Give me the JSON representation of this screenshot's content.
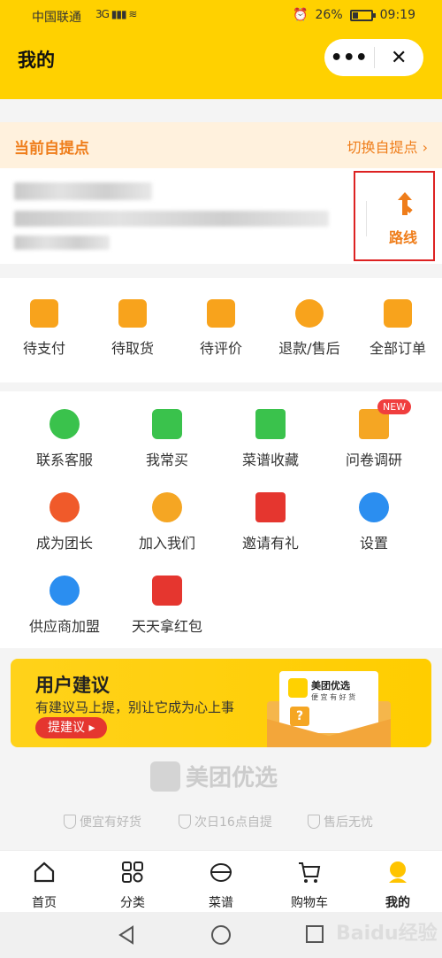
{
  "status": {
    "carrier": "中国联通",
    "network": "3G",
    "battery": "26%",
    "time": "09:19"
  },
  "header": {
    "title": "我的",
    "more": "•••",
    "close": "✕"
  },
  "pickup": {
    "label": "当前自提点",
    "switch": "切换自提点",
    "route": "路线"
  },
  "orders": [
    {
      "label": "待支付",
      "icon": "wallet-icon"
    },
    {
      "label": "待取货",
      "icon": "box-icon"
    },
    {
      "label": "待评价",
      "icon": "comment-icon"
    },
    {
      "label": "退款/售后",
      "icon": "refund-icon"
    },
    {
      "label": "全部订单",
      "icon": "clipboard-icon"
    }
  ],
  "tools": [
    {
      "label": "联系客服",
      "icon": "headset-icon",
      "color": "#3ac24c"
    },
    {
      "label": "我常买",
      "icon": "basket-icon",
      "color": "#3ac24c"
    },
    {
      "label": "菜谱收藏",
      "icon": "book-star-icon",
      "color": "#3ac24c"
    },
    {
      "label": "问卷调研",
      "icon": "question-icon",
      "color": "#f5a623"
    },
    {
      "label": "成为团长",
      "icon": "leader-icon",
      "color": "#f05a2a"
    },
    {
      "label": "加入我们",
      "icon": "people-icon",
      "color": "#f5a623"
    },
    {
      "label": "邀请有礼",
      "icon": "coupon-icon",
      "color": "#e5362f"
    },
    {
      "label": "设置",
      "icon": "gear-icon",
      "color": "#2b8ef0"
    },
    {
      "label": "供应商加盟",
      "icon": "handshake-icon",
      "color": "#2b8ef0"
    },
    {
      "label": "天天拿红包",
      "icon": "redpacket-icon",
      "color": "#e5362f"
    }
  ],
  "new_badge": "NEW",
  "banner": {
    "title": "用户建议",
    "subtitle": "有建议马上提，别让它成为心上事",
    "button": "提建议 ▸",
    "card_title": "美团优选",
    "card_sub": "便 宜 有 好 货",
    "card_q": "?"
  },
  "brand": {
    "name": "美团优选"
  },
  "assurances": [
    "便宜有好货",
    "次日16点自提",
    "售后无忧"
  ],
  "tabbar": [
    {
      "label": "首页",
      "icon": "home-icon"
    },
    {
      "label": "分类",
      "icon": "category-icon"
    },
    {
      "label": "菜谱",
      "icon": "recipe-icon"
    },
    {
      "label": "购物车",
      "icon": "cart-icon"
    },
    {
      "label": "我的",
      "icon": "profile-icon",
      "active": true
    }
  ],
  "watermark": "Baidu经验"
}
